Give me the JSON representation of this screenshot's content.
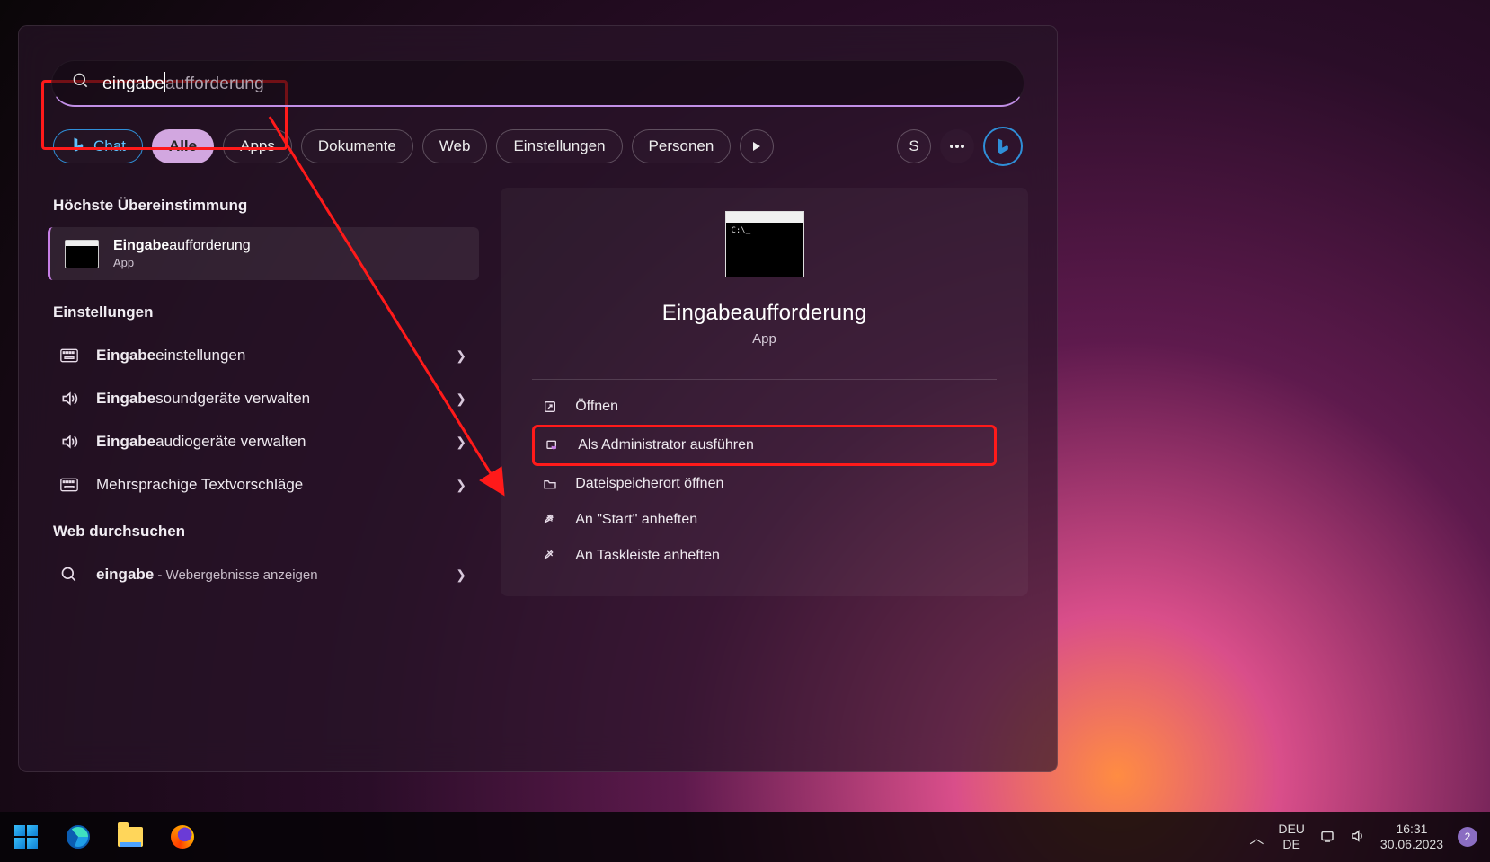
{
  "search": {
    "typed": "eingabe",
    "completion": "aufforderung"
  },
  "filters": {
    "chat": "Chat",
    "alle": "Alle",
    "apps": "Apps",
    "docs": "Dokumente",
    "web": "Web",
    "settings": "Einstellungen",
    "people": "Personen",
    "avatar": "S"
  },
  "sections": {
    "bestMatch": "Höchste Übereinstimmung",
    "settings": "Einstellungen",
    "webSearch": "Web durchsuchen"
  },
  "bestMatch": {
    "titleBold": "Eingabe",
    "titleRest": "aufforderung",
    "sub": "App"
  },
  "settingsItems": [
    {
      "bold": "Eingabe",
      "rest": "einstellungen",
      "icon": "keyboard"
    },
    {
      "bold": "Eingabe",
      "rest": "soundgeräte verwalten",
      "icon": "sound"
    },
    {
      "bold": "Eingabe",
      "rest": "audiogeräte verwalten",
      "icon": "sound"
    },
    {
      "bold": "",
      "rest": "Mehrsprachige Textvorschläge",
      "icon": "keyboard"
    }
  ],
  "webItem": {
    "bold": "eingabe",
    "rest": " - Webergebnisse anzeigen"
  },
  "preview": {
    "title": "Eingabeaufforderung",
    "sub": "App"
  },
  "actions": {
    "open": "Öffnen",
    "admin": "Als Administrator ausführen",
    "location": "Dateispeicherort öffnen",
    "pinStart": "An \"Start\" anheften",
    "pinTaskbar": "An Taskleiste anheften"
  },
  "taskbar": {
    "lang1": "DEU",
    "lang2": "DE",
    "time": "16:31",
    "date": "30.06.2023",
    "notifCount": "2"
  }
}
